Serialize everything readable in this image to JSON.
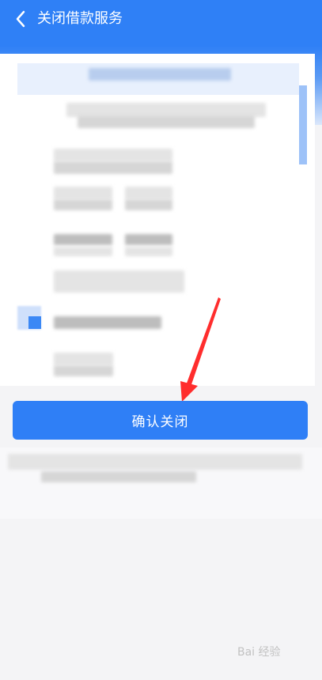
{
  "header": {
    "title": "关闭借款服务"
  },
  "confirm_button": {
    "label": "确认关闭"
  },
  "colors": {
    "primary": "#2f80f6",
    "button": "#2f7ff6",
    "arrow": "#ff2d2d"
  },
  "watermark": {
    "text": "Bai 经验"
  }
}
